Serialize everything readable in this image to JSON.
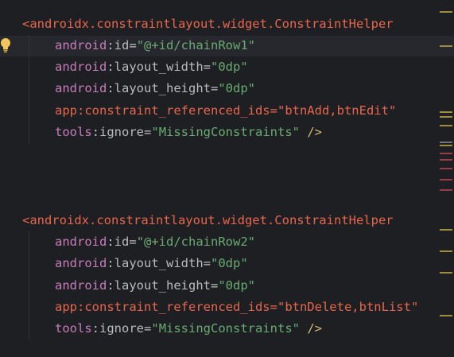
{
  "editor": {
    "block1": {
      "open_bracket": "<",
      "tag": "androidx.constraintlayout.widget.ConstraintHelper",
      "attrs": [
        {
          "ns": "android",
          "name": "id",
          "value": "\"@+id/chainRow1\""
        },
        {
          "ns": "android",
          "name": "layout_width",
          "value": "\"0dp\""
        },
        {
          "ns": "android",
          "name": "layout_height",
          "value": "\"0dp\""
        },
        {
          "ns": "app",
          "name": "constraint_referenced_ids",
          "value": "\"btnAdd,btnEdit\""
        },
        {
          "ns": "tools",
          "name": "ignore",
          "value": "\"MissingConstraints\""
        }
      ],
      "close": " />"
    },
    "block2": {
      "open_bracket": "<",
      "tag": "androidx.constraintlayout.widget.ConstraintHelper",
      "attrs": [
        {
          "ns": "android",
          "name": "id",
          "value": "\"@+id/chainRow2\""
        },
        {
          "ns": "android",
          "name": "layout_width",
          "value": "\"0dp\""
        },
        {
          "ns": "android",
          "name": "layout_height",
          "value": "\"0dp\""
        },
        {
          "ns": "app",
          "name": "constraint_referenced_ids",
          "value": "\"btnDelete,btnList\""
        },
        {
          "ns": "tools",
          "name": "ignore",
          "value": "\"MissingConstraints\""
        }
      ],
      "close": " />"
    },
    "colon": ":",
    "equals": "=",
    "gutter_icon": "lightbulb-icon"
  }
}
